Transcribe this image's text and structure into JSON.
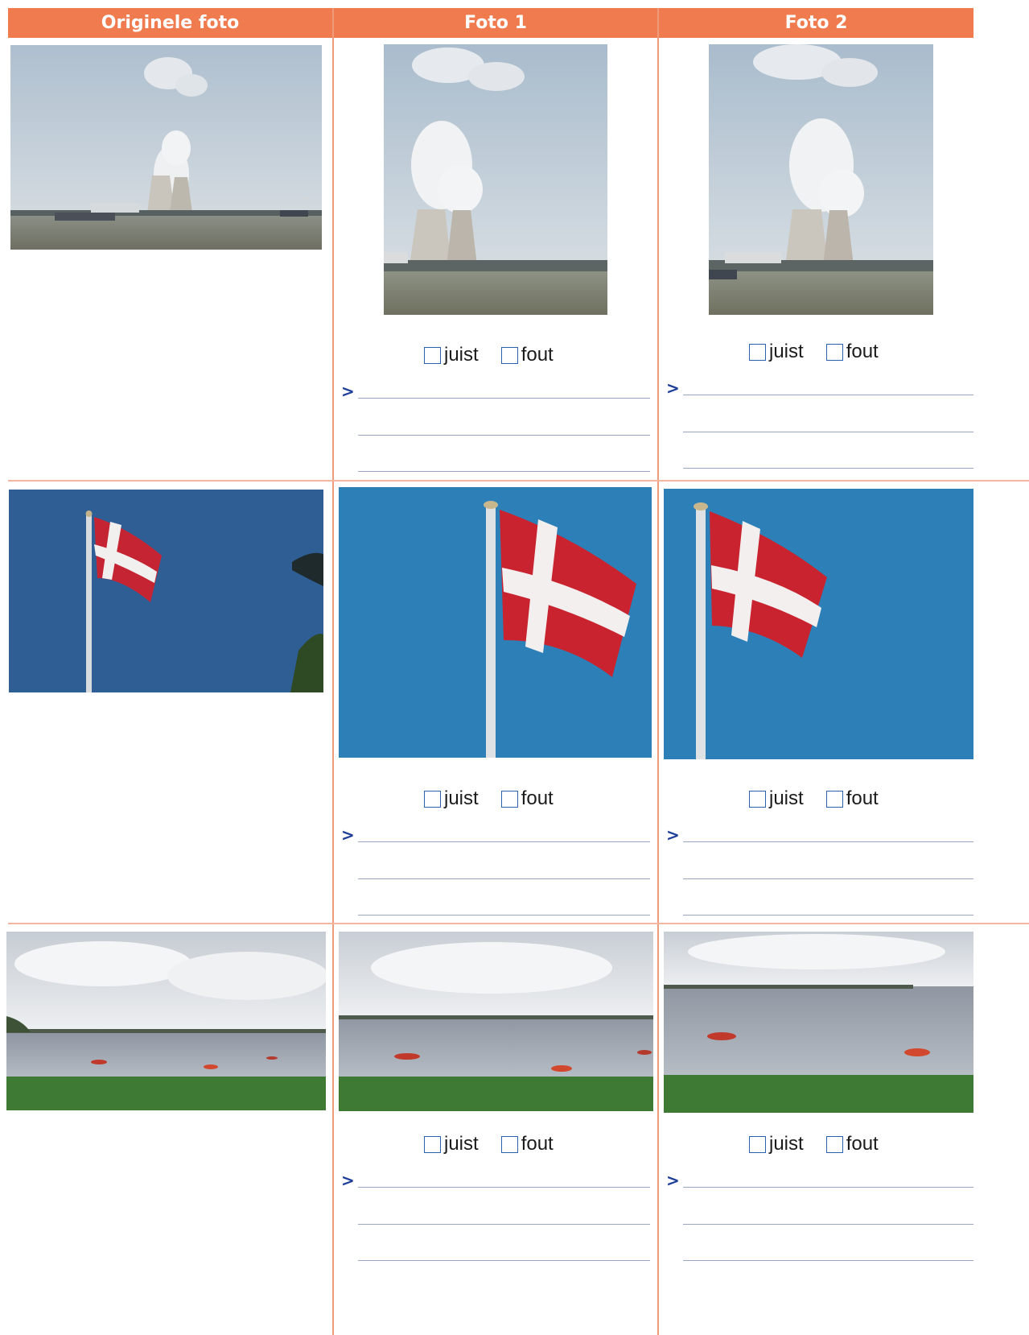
{
  "headers": [
    "Originele foto",
    "Foto 1",
    "Foto 2"
  ],
  "options": {
    "right": "juist",
    "wrong": "fout"
  },
  "answer_marker": ">",
  "colors": {
    "header": "#ef7b4f",
    "grid": "#ef9a7b",
    "checkbox": "#2b62b0",
    "marker": "#1f3f99"
  },
  "rows": [
    {
      "subject": "kerncentrale met koeltorens aan het water"
    },
    {
      "subject": "Deense vlag aan een vlaggenmast"
    },
    {
      "subject": "meer met bootjes en riet"
    }
  ]
}
